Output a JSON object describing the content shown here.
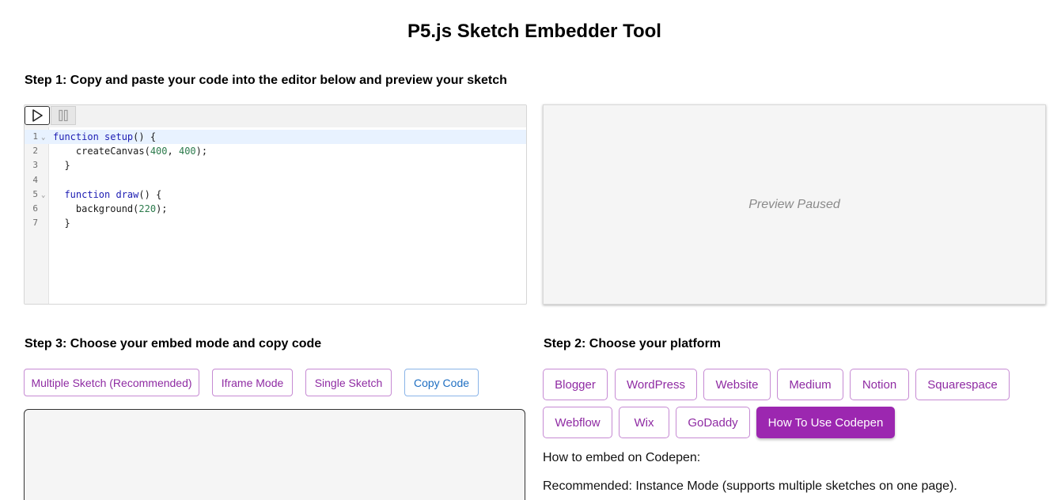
{
  "title": "P5.js Sketch Embedder Tool",
  "step1": {
    "heading": "Step 1: Copy and paste your code into the editor below and preview your sketch"
  },
  "editor": {
    "toolbar": {
      "play_icon": "play-icon",
      "pause_icon": "pause-icon"
    },
    "lines": [
      {
        "num": "1",
        "fold": true
      },
      {
        "num": "2",
        "fold": false
      },
      {
        "num": "3",
        "fold": false
      },
      {
        "num": "4",
        "fold": false
      },
      {
        "num": "5",
        "fold": true
      },
      {
        "num": "6",
        "fold": false
      },
      {
        "num": "7",
        "fold": false
      }
    ],
    "code": {
      "l1_kw": "function",
      "l1_fn": "setup",
      "l1_rest": "() {",
      "l2_a": "    createCanvas(",
      "l2_n1": "400",
      "l2_b": ", ",
      "l2_n2": "400",
      "l2_c": ");",
      "l3": "  }",
      "l5_kw": "  function",
      "l5_fn": "draw",
      "l5_rest": "() {",
      "l6_a": "    background(",
      "l6_n": "220",
      "l6_b": ");",
      "l7": "  }"
    }
  },
  "preview": {
    "text": "Preview Paused"
  },
  "step3": {
    "heading": "Step 3: Choose your embed mode and copy code",
    "buttons": {
      "multiple": "Multiple Sketch (Recommended)",
      "iframe": "Iframe Mode",
      "single": "Single Sketch",
      "copy": "Copy Code"
    }
  },
  "step2": {
    "heading": "Step 2: Choose your platform",
    "platforms": {
      "blogger": "Blogger",
      "wordpress": "WordPress",
      "website": "Website",
      "medium": "Medium",
      "notion": "Notion",
      "squarespace": "Squarespace",
      "webflow": "Webflow",
      "wix": "Wix",
      "godaddy": "GoDaddy",
      "codepen": "How To Use Codepen"
    },
    "selected": "How To Use Codepen",
    "info_title": "How to embed on Codepen:",
    "info_recommended": "Recommended: Instance Mode (supports multiple sketches on one page)."
  },
  "colors": {
    "accent_purple": "#9c27b0",
    "button_text_purple": "#8f2ba3",
    "copy_blue": "#1f6fc2"
  }
}
